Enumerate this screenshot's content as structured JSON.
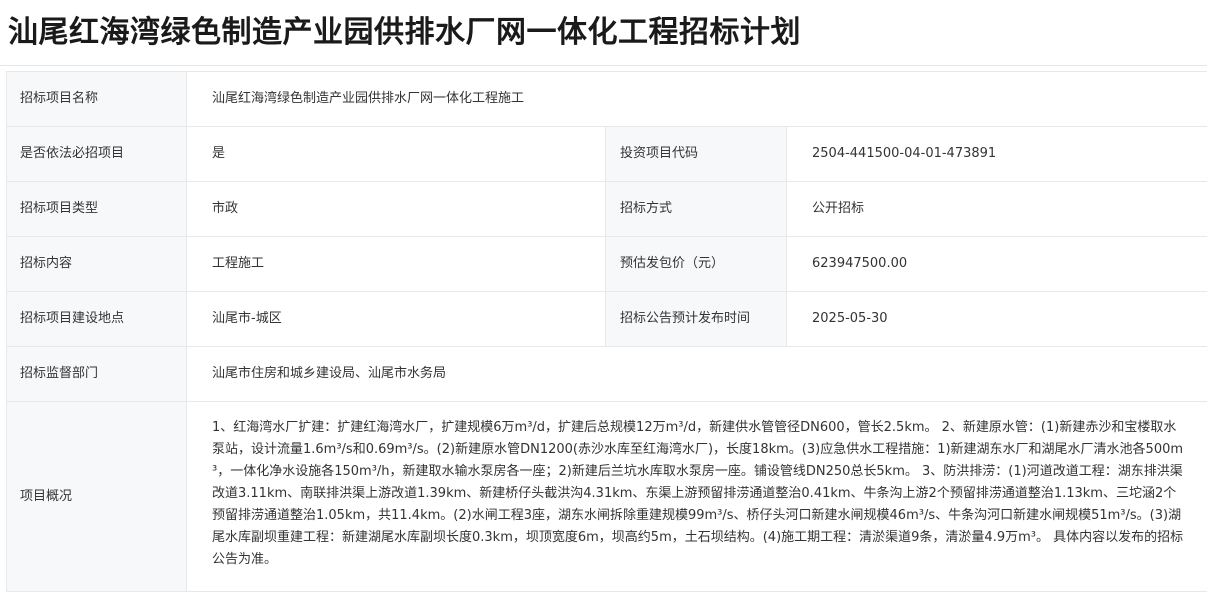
{
  "page": {
    "title": "汕尾红海湾绿色制造产业园供排水厂网一体化工程招标计划"
  },
  "rows": {
    "project_name": {
      "label": "招标项目名称",
      "value": "汕尾红海湾绿色制造产业园供排水厂网一体化工程施工"
    },
    "mandatory": {
      "label": "是否依法必招项目",
      "value": "是"
    },
    "investment_code": {
      "label": "投资项目代码",
      "value": "2504-441500-04-01-473891"
    },
    "project_type": {
      "label": "招标项目类型",
      "value": "市政"
    },
    "method": {
      "label": "招标方式",
      "value": "公开招标"
    },
    "content": {
      "label": "招标内容",
      "value": "工程施工"
    },
    "price": {
      "label": "预估发包价（元）",
      "value": "623947500.00"
    },
    "location": {
      "label": "招标项目建设地点",
      "value": "汕尾市-城区"
    },
    "publish_time": {
      "label": "招标公告预计发布时间",
      "value": "2025-05-30"
    },
    "supervisor": {
      "label": "招标监督部门",
      "value": "汕尾市住房和城乡建设局、汕尾市水务局"
    },
    "overview": {
      "label": "项目概况",
      "value": "1、红海湾水厂扩建：扩建红海湾水厂，扩建规模6万m³/d，扩建后总规模12万m³/d，新建供水管管径DN600，管长2.5km。 2、新建原水管：(1)新建赤沙和宝楼取水泵站，设计流量1.6m³/s和0.69m³/s。(2)新建原水管DN1200(赤沙水库至红海湾水厂)，长度18km。(3)应急供水工程措施：1)新建湖东水厂和湖尾水厂清水池各500m³，一体化净水设施各150m³/h，新建取水输水泵房各一座；2)新建后兰坑水库取水泵房一座。铺设管线DN250总长5km。 3、防洪排涝：(1)河道改道工程：湖东排洪渠改道3.11km、南联排洪渠上游改道1.39km、新建桥仔头截洪沟4.31km、东渠上游预留排涝通道整治0.41km、牛条沟上游2个预留排涝通道整治1.13km、三坨涵2个预留排涝通道整治1.05km，共11.4km。(2)水闸工程3座，湖东水闸拆除重建规模99m³/s、桥仔头河口新建水闸规模46m³/s、牛条沟河口新建水闸规模51m³/s。(3)湖尾水库副坝重建工程：新建湖尾水库副坝长度0.3km，坝顶宽度6m，坝高约5m，土石坝结构。(4)施工期工程：清淤渠道9条，清淤量4.9万m³。 具体内容以发布的招标公告为准。"
    }
  }
}
